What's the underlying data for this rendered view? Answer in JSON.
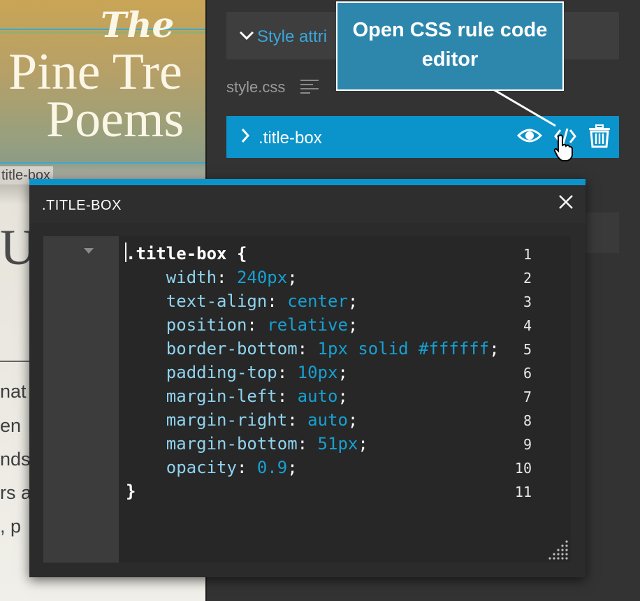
{
  "preview": {
    "title_the": "The",
    "title_line1": "Pine Tre",
    "title_line2": "Poems",
    "selected_label": "title-box",
    "big_letter": "U",
    "paragraph_fragments": [
      "nat",
      "en",
      "nds",
      "rs a",
      ", p"
    ]
  },
  "panel": {
    "style_attr_label": "Style attri",
    "css_file": "style.css",
    "rule_selector": ".title-box"
  },
  "tooltip": {
    "text_line1": "Open CSS rule code",
    "text_line2": "editor"
  },
  "dialog": {
    "title": ".TITLE-BOX",
    "code_lines": [
      {
        "num": "1",
        "selector": ".title-box {"
      },
      {
        "num": "2",
        "prop": "width",
        "value": "240px"
      },
      {
        "num": "3",
        "prop": "text-align",
        "value": "center"
      },
      {
        "num": "4",
        "prop": "position",
        "value": "relative"
      },
      {
        "num": "5",
        "prop": "border-bottom",
        "value": "1px solid #ffffff"
      },
      {
        "num": "6",
        "prop": "padding-top",
        "value": "10px"
      },
      {
        "num": "7",
        "prop": "margin-left",
        "value": "auto"
      },
      {
        "num": "8",
        "prop": "margin-right",
        "value": "auto"
      },
      {
        "num": "9",
        "prop": "margin-bottom",
        "value": "51px"
      },
      {
        "num": "10",
        "prop": "opacity",
        "value": "0.9"
      },
      {
        "num": "11",
        "selector": "}"
      }
    ]
  },
  "colors": {
    "accent": "#0a94cb",
    "tooltip_bg": "#2d87ad",
    "code_value": "#16a0d2",
    "code_property": "#8fd3ee"
  },
  "icons": [
    "chevron-down-icon",
    "align-left-icon",
    "chevron-right-icon",
    "eye-icon",
    "code-icon",
    "trash-icon",
    "hand-cursor-icon",
    "close-icon",
    "fold-arrow-icon",
    "resize-grip-icon"
  ]
}
